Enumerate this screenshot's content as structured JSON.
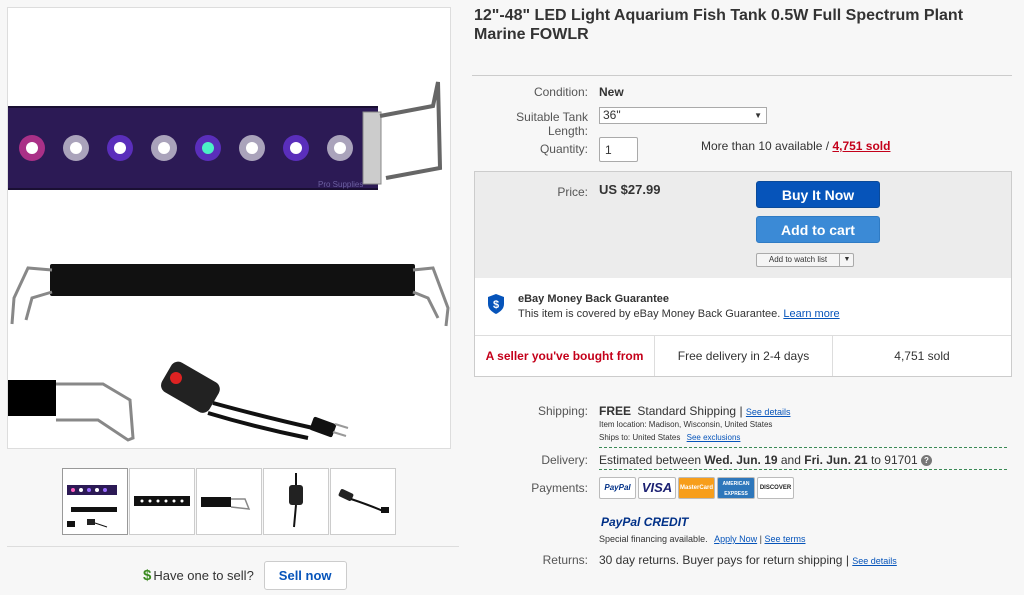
{
  "title": "12\"-48\" LED Light Aquarium Fish Tank 0.5W Full Spectrum Plant Marine FOWLR",
  "image": {
    "watermark": "Pro Supplies"
  },
  "details": {
    "condition_label": "Condition:",
    "condition_value": "New",
    "tank_length_label": "Suitable Tank Length:",
    "tank_length_value": "36\"",
    "quantity_label": "Quantity:",
    "quantity_value": "1",
    "availability": "More than 10 available",
    "slash": " / ",
    "sold_link": "4,751 sold"
  },
  "buybox": {
    "price_label": "Price:",
    "price_value": "US $27.99",
    "buy_now": "Buy It Now",
    "add_to_cart": "Add to cart",
    "watch_list": "Add to watch list",
    "guarantee_title": "eBay Money Back Guarantee",
    "guarantee_text": "This item is covered by eBay Money Back Guarantee.",
    "learn_more": "Learn more",
    "seller_note": "A seller you've bought from",
    "delivery_note": "Free delivery in 2-4 days",
    "sold_note": "4,751 sold"
  },
  "shipping": {
    "label": "Shipping:",
    "free": "FREE",
    "method": "Standard Shipping",
    "sep": "|",
    "see_details": "See details",
    "item_location": "Item location:  Madison, Wisconsin, United States",
    "ships_to": "Ships to:  United States",
    "see_exclusions": "See exclusions"
  },
  "delivery": {
    "label": "Delivery:",
    "text_pre": "Estimated between ",
    "date1": "Wed. Jun. 19",
    "and": " and ",
    "date2": "Fri. Jun. 21",
    "to": " to 91701",
    "help": "?"
  },
  "payments": {
    "label": "Payments:",
    "badges": [
      "PayPal",
      "VISA",
      "MasterCard",
      "AMERICAN EXPRESS",
      "DISCOVER"
    ],
    "paypal_credit_a": "PayPal",
    "paypal_credit_b": "CREDIT",
    "financing": "Special financing available.",
    "apply_now": "Apply Now",
    "sep": "|",
    "see_terms": "See terms"
  },
  "returns": {
    "label": "Returns:",
    "text": "30 day returns. Buyer pays for return shipping",
    "sep": "|",
    "see_details": "See details"
  },
  "sell": {
    "dollar": "$",
    "question": "Have one to sell?",
    "button": "Sell now"
  },
  "colors": {
    "ebay_blue": "#0654ba",
    "cart_blue": "#3b8ad6",
    "sold_red": "#c4001a",
    "green": "#3a8a1f"
  }
}
